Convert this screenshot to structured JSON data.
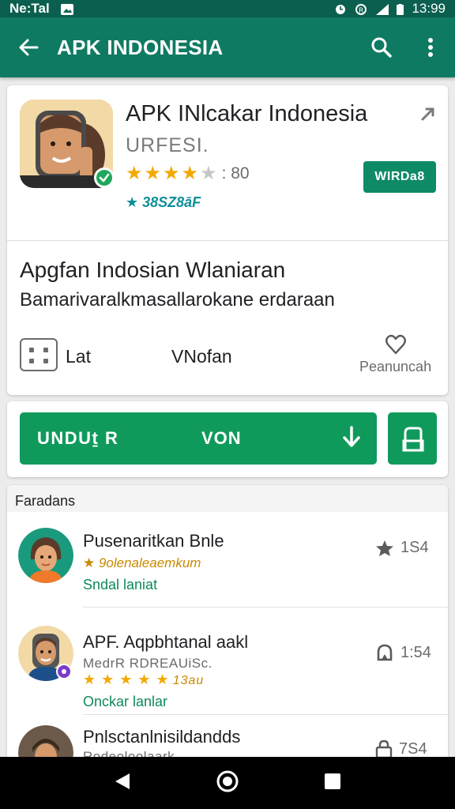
{
  "status_bar": {
    "carrier": "Ne:Tal",
    "time": "13:99"
  },
  "app_bar": {
    "title": "APK INDONESIA",
    "back_icon": "arrow-back-icon",
    "search_icon": "search-icon",
    "menu_icon": "more-vert-icon",
    "color": "#0f7a62"
  },
  "app_card": {
    "name": "APK INlcakar Indonesia",
    "developer": "URFESI.",
    "rating_stars": 4,
    "rating_max": 5,
    "rating_count": ": 80",
    "downloads": "★ 38SZ8āF",
    "badge_label": "WIRDa8",
    "promo_title": "Apgfan Indosian Wlaniaran",
    "promo_desc": "Bamarivaralkmasallarokane erdaraan",
    "feature_1": "Lat",
    "feature_2": "VNofan",
    "feature_3": "Peanuncah"
  },
  "install": {
    "label_1": "UNDUṯ R",
    "label_2": "VON",
    "accent": "#0f9a5c"
  },
  "list": {
    "header": "Faradans",
    "items": [
      {
        "name": "Pusenaritkan Bnle",
        "line2": "★ 9olenaleaemkum",
        "line3": "Sndal  laniat",
        "meta": "1S4"
      },
      {
        "name": "APF. Aqpbhtanal aakl",
        "line2": "MedrR RDREAUiSc.",
        "stars": "★ ★ ★ ★ ★",
        "stars_value": "13au",
        "line3": "Onckar lanlar",
        "meta": "1:54"
      },
      {
        "name": "Pnlsctanlnisildandds",
        "line2": "Rodeoloolaark",
        "meta": "7S4"
      }
    ]
  }
}
